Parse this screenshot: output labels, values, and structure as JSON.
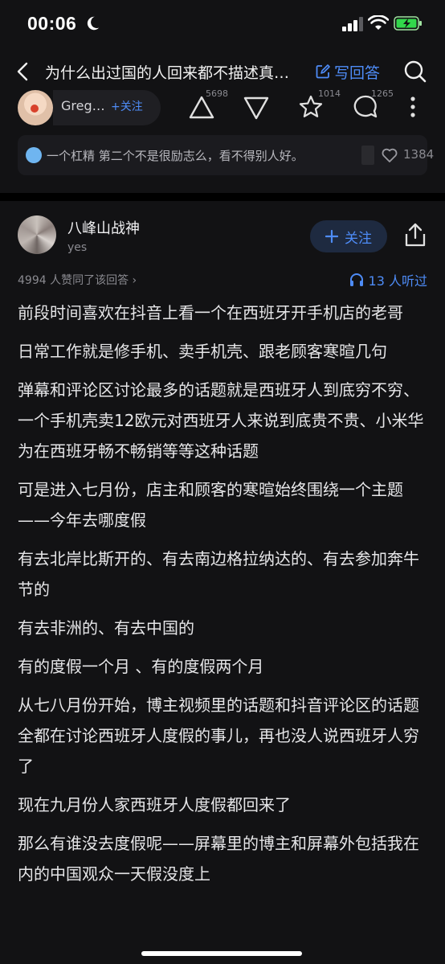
{
  "status_bar": {
    "time": "00:06"
  },
  "nav": {
    "title": "为什么出过国的人回来都不描述真…",
    "write_answer": "写回答"
  },
  "prev_answer": {
    "author_name": "Greg…",
    "follow_label": "+关注",
    "upvotes": "5698",
    "favorites": "1014",
    "comments": "1265"
  },
  "top_comment": {
    "text": "一个杠精 第二个不是很励志么，看不得别人好。",
    "likes": "1384"
  },
  "answer": {
    "author_name": "八峰山战神",
    "author_bio": "yes",
    "follow_label": "关注",
    "agree_text": "4994 人赞同了该回答 ›",
    "listen_text": "13 人听过",
    "paragraphs": [
      "前段时间喜欢在抖音上看一个在西班牙开手机店的老哥",
      "日常工作就是修手机、卖手机壳、跟老顾客寒暄几句",
      "弹幕和评论区讨论最多的话题就是西班牙人到底穷不穷、一个手机壳卖12欧元对西班牙人来说到底贵不贵、小米华为在西班牙畅不畅销等等这种话题",
      "可是进入七月份，店主和顾客的寒暄始终围绕一个主题——今年去哪度假",
      "有去北岸比斯开的、有去南边格拉纳达的、有去参加奔牛节的",
      "有去非洲的、有去中国的",
      "有的度假一个月 、有的度假两个月",
      "从七八月份开始，博主视频里的话题和抖音评论区的话题全都在讨论西班牙人度假的事儿，再也没人说西班牙人穷了",
      "现在九月份人家西班牙人度假都回来了",
      "那么有谁没去度假呢——屏幕里的博主和屏幕外包括我在内的中国观众一天假没度上"
    ]
  },
  "colors": {
    "background": "#121214",
    "accent": "#4e8cf7",
    "text": "#e6e6e8",
    "muted": "#8a8a90"
  }
}
